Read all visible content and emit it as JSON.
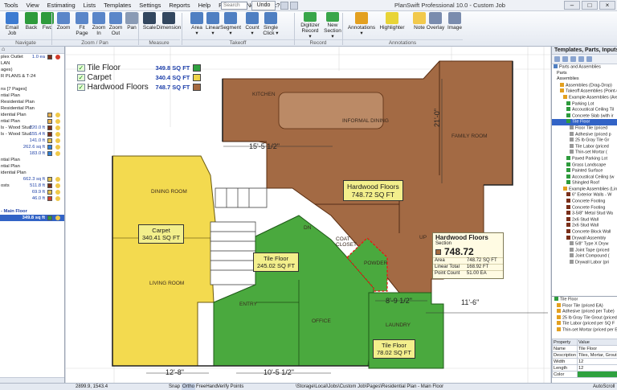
{
  "app": {
    "title": "PlanSwift Professional 10.0 - Custom Job"
  },
  "menu": [
    "Tools",
    "View",
    "Estimating",
    "Lists",
    "Templates",
    "Settings",
    "Reports",
    "Help",
    "Plugins",
    "Need Work?"
  ],
  "search": {
    "placeholder": "Search"
  },
  "undo_label": "Undo",
  "ribbon": {
    "buttons": [
      {
        "label": "Email\nJob",
        "color": "#3d7bd1"
      },
      {
        "label": "Back",
        "color": "#2e9b3c"
      },
      {
        "label": "Fwd",
        "color": "#2e9b3c"
      },
      {
        "label": "Zoom",
        "color": "#5a86c9"
      },
      {
        "label": "Fit\nPage",
        "color": "#5a86c9"
      },
      {
        "label": "Zoom\nIn",
        "color": "#5a86c9"
      },
      {
        "label": "Zoom\nOut",
        "color": "#5a86c9"
      },
      {
        "label": "Pan",
        "color": "#8a9bb5"
      },
      {
        "label": "Scale",
        "color": "#33475f"
      },
      {
        "label": "Dimension",
        "color": "#33475f"
      },
      {
        "label": "Area\n▾",
        "color": "#4f7fc2"
      },
      {
        "label": "Linear\n▾",
        "color": "#4f7fc2"
      },
      {
        "label": "Segment\n▾",
        "color": "#4f7fc2"
      },
      {
        "label": "Count\n▾",
        "color": "#4f7fc2"
      },
      {
        "label": "Single\nClick ▾",
        "color": "#4f7fc2"
      },
      {
        "label": "Digitizer\nRecord ▾",
        "color": "#39a64a"
      },
      {
        "label": "New\nSection ▾",
        "color": "#39a64a"
      },
      {
        "label": "Annotations\n▾",
        "color": "#e3a020"
      },
      {
        "label": "Highlighter",
        "color": "#e8d437"
      },
      {
        "label": "Note",
        "color": "#f2c94c"
      },
      {
        "label": "Overlay",
        "color": "#7a8cae"
      },
      {
        "label": "Image",
        "color": "#7a8cae"
      }
    ],
    "groups": [
      "Navigate",
      "Zoom / Pan",
      "Measure",
      "Takeoff",
      "Record",
      "Annotations"
    ]
  },
  "left_panel": {
    "rows": [
      {
        "text": "plex Outlet",
        "value": "1.0 ea",
        "swatch": "#7a2f1a",
        "icon": "#d23b2b"
      },
      {
        "text": "LAN",
        "value": "",
        "swatch": "",
        "icon": ""
      },
      {
        "text": "ages)",
        "value": "",
        "swatch": "",
        "icon": ""
      },
      {
        "text": "R PLANS & T-24",
        "value": "",
        "swatch": "",
        "icon": ""
      },
      {
        "text": "",
        "value": "",
        "swatch": "",
        "icon": ""
      },
      {
        "text": "ns [7 Pages]",
        "value": "",
        "swatch": "",
        "icon": ""
      },
      {
        "text": "ntial Plan",
        "value": "",
        "swatch": "",
        "icon": ""
      },
      {
        "text": "Residential Plan",
        "value": "",
        "swatch": "",
        "icon": ""
      },
      {
        "text": "Residential Plan",
        "value": "",
        "swatch": "",
        "icon": ""
      },
      {
        "text": "idential Plan",
        "value": "",
        "swatch": "#e7b04b",
        "icon": "#f0c94a"
      },
      {
        "text": "ntial Plan",
        "value": "",
        "swatch": "#e7b04b",
        "icon": "#f0c94a"
      },
      {
        "text": "ls - Wood Stud",
        "value": "220.0 ft",
        "swatch": "#7a2f1a",
        "icon": "#f0c94a"
      },
      {
        "text": "ls - Wood Stud",
        "value": "155.4 ft",
        "swatch": "#7a2f1a",
        "icon": "#f0c94a"
      },
      {
        "text": "",
        "value": "141.0 ft",
        "swatch": "#e3c14a",
        "icon": "#f0c94a"
      },
      {
        "text": "",
        "value": "262.6 sq ft",
        "swatch": "#2d7fd6",
        "icon": "#f0c94a"
      },
      {
        "text": "",
        "value": "183.0 ft",
        "swatch": "#2d7fd6",
        "icon": "#f0c94a"
      },
      {
        "text": "ntial Plan",
        "value": "",
        "swatch": "",
        "icon": ""
      },
      {
        "text": "ntial Plan",
        "value": "",
        "swatch": "",
        "icon": ""
      },
      {
        "text": "idential Plan",
        "value": "",
        "swatch": "",
        "icon": ""
      },
      {
        "text": "",
        "value": "662.3 sq ft",
        "swatch": "#e3c14a",
        "icon": "#f0c94a"
      },
      {
        "text": "osts",
        "value": "511.8 ft",
        "swatch": "#7a2f1a",
        "icon": "#f0c94a"
      },
      {
        "text": "",
        "value": "69.9 ft",
        "swatch": "#e3c14a",
        "icon": "#f0c94a"
      },
      {
        "text": "",
        "value": "46.0 ft",
        "swatch": "#d23b2b",
        "icon": "#f0c94a"
      },
      {
        "text": "",
        "value": "",
        "swatch": "",
        "icon": ""
      },
      {
        "text": "- Main Floor",
        "value": "",
        "swatch": "",
        "icon": "",
        "blue": true
      },
      {
        "text": "",
        "value": "349.8 sq ft",
        "swatch": "#2e9b3c",
        "icon": "#f0c94a",
        "selected": true
      }
    ]
  },
  "legend": [
    {
      "name": "Tile Floor",
      "amount": "349.8 SQ FT",
      "color": "#2fa13f"
    },
    {
      "name": "Carpet",
      "amount": "340.4 SQ FT",
      "color": "#efd449"
    },
    {
      "name": "Hardwood Floors",
      "amount": "748.7 SQ FT",
      "color": "#a66a40"
    }
  ],
  "labels": {
    "hardwood": "Hardwood Floors\n748.72 SQ FT",
    "carpet": "Carpet\n340.41 SQ FT",
    "tile1": "Tile Floor\n245.02 SQ FT",
    "tile2": "Tile Floor\n78.02 SQ FT"
  },
  "rooms": {
    "kitchen": "KITCHEN",
    "informal_dining": "INFORMAL DINING",
    "family_room": "FAMILY ROOM",
    "dining_room": "DINING ROOM",
    "living_room": "LIVING ROOM",
    "entry": "ENTRY",
    "office": "OFFICE",
    "laundry": "LAUNDRY",
    "powder": "POWDER",
    "coat_closet": "COAT\nCLOSET",
    "dn": "DN",
    "up": "UP"
  },
  "dims": {
    "d1": "15'-5 1/2\"",
    "d2": "21'-0\"",
    "d3": "8'-9 1/2\"",
    "d4": "11'-6\"",
    "d5": "12'-8\"",
    "d6": "10'-5 1/2\""
  },
  "popup": {
    "title": "Hardwood Floors",
    "subtitle": "Section",
    "value": "748.72",
    "rows": [
      [
        "Area",
        "748.72 SQ FT"
      ],
      [
        "Linear Total",
        "168.92 FT"
      ],
      [
        "Point Count",
        "51.00 EA"
      ]
    ]
  },
  "right_panel": {
    "title": "Templates, Parts, Inputs",
    "rows": [
      {
        "text": "Parts and Assemblies",
        "indent": 1,
        "color": "#4f7fc2"
      },
      {
        "text": "Parts",
        "indent": 2,
        "color": ""
      },
      {
        "text": "Assemblies",
        "indent": 2,
        "color": ""
      },
      {
        "text": "Assemblies (Drag-Drop)",
        "indent": 3,
        "color": "#e3a020"
      },
      {
        "text": "Takeoff Assemblies (Point-Cl",
        "indent": 3,
        "color": "#e3a020"
      },
      {
        "text": "Example Assemblies (Area",
        "indent": 4,
        "color": "#e3a020"
      },
      {
        "text": "Parking Lot",
        "indent": 5,
        "color": "#2e9b3c"
      },
      {
        "text": "Accoustical Ceiling Til",
        "indent": 5,
        "color": "#2e9b3c"
      },
      {
        "text": "Concrete Slab (with ir",
        "indent": 5,
        "color": "#2e9b3c"
      },
      {
        "text": "Tile Floor",
        "indent": 5,
        "color": "#2e9b3c",
        "selected": true
      },
      {
        "text": "Floor Tile (priced",
        "indent": 6,
        "color": "#999"
      },
      {
        "text": "Adhesive (priced p",
        "indent": 6,
        "color": "#999"
      },
      {
        "text": "25 lb Gray Tile Gr",
        "indent": 6,
        "color": "#999"
      },
      {
        "text": "Tile Labor (priced",
        "indent": 6,
        "color": "#999"
      },
      {
        "text": "Thin-set Mortar (",
        "indent": 6,
        "color": "#999"
      },
      {
        "text": "Paved Parking Lot",
        "indent": 5,
        "color": "#2e9b3c"
      },
      {
        "text": "Grass Landscape",
        "indent": 5,
        "color": "#2e9b3c"
      },
      {
        "text": "Painted Surface",
        "indent": 5,
        "color": "#2e9b3c"
      },
      {
        "text": "Accoustical Ceiling (w",
        "indent": 5,
        "color": "#2e9b3c"
      },
      {
        "text": "Shingled Roof",
        "indent": 5,
        "color": "#2e9b3c"
      },
      {
        "text": "Example Assemblies (Line",
        "indent": 4,
        "color": "#e3a020"
      },
      {
        "text": "6\" Exterior Walls - W",
        "indent": 5,
        "color": "#7a2f1a"
      },
      {
        "text": "Concrete Footing",
        "indent": 5,
        "color": "#7a2f1a"
      },
      {
        "text": "Concrete Footing",
        "indent": 5,
        "color": "#7a2f1a"
      },
      {
        "text": "3-5/8\" Metal Stud Wa",
        "indent": 5,
        "color": "#7a2f1a"
      },
      {
        "text": "2x6 Stud Wall",
        "indent": 5,
        "color": "#7a2f1a"
      },
      {
        "text": "2x6 Stud Wall",
        "indent": 5,
        "color": "#7a2f1a"
      },
      {
        "text": "Concrete Block Wall",
        "indent": 5,
        "color": "#7a2f1a"
      },
      {
        "text": "Drywall Assembly",
        "indent": 5,
        "color": "#7a2f1a"
      },
      {
        "text": "5/8\" Type X Dryw",
        "indent": 6,
        "color": "#999"
      },
      {
        "text": "Joint Tape (priced",
        "indent": 6,
        "color": "#999"
      },
      {
        "text": "Joint Compound (",
        "indent": 6,
        "color": "#999"
      },
      {
        "text": "Drywall Labor (pri",
        "indent": 6,
        "color": "#999"
      }
    ],
    "list2": [
      "Tile Floor",
      "Floor Tile (priced EA)",
      "Adhesive (priced per Tube)",
      "25 lb Gray Tile Grout (priced",
      "Tile Labor (priced per SQ F",
      "Thin-set Mortar (priced per E"
    ],
    "props": [
      [
        "Property",
        "Value"
      ],
      [
        "Name",
        "Tile Floor"
      ],
      [
        "Description",
        "Tiles, Mortar, Grout"
      ],
      [
        "Width",
        "12"
      ],
      [
        "Length",
        "12"
      ],
      [
        "Color",
        ""
      ]
    ]
  },
  "status": {
    "coords": "2899.9, 1543.4",
    "snap": "Snap",
    "ortho": "Ortho",
    "freehand": "FreeHand",
    "verify": "Verify Points",
    "path": "\\Storage\\Local\\Jobs\\Custom Job\\Pages\\Residential Plan - Main Floor",
    "autoscroll": "AutoScroll"
  }
}
